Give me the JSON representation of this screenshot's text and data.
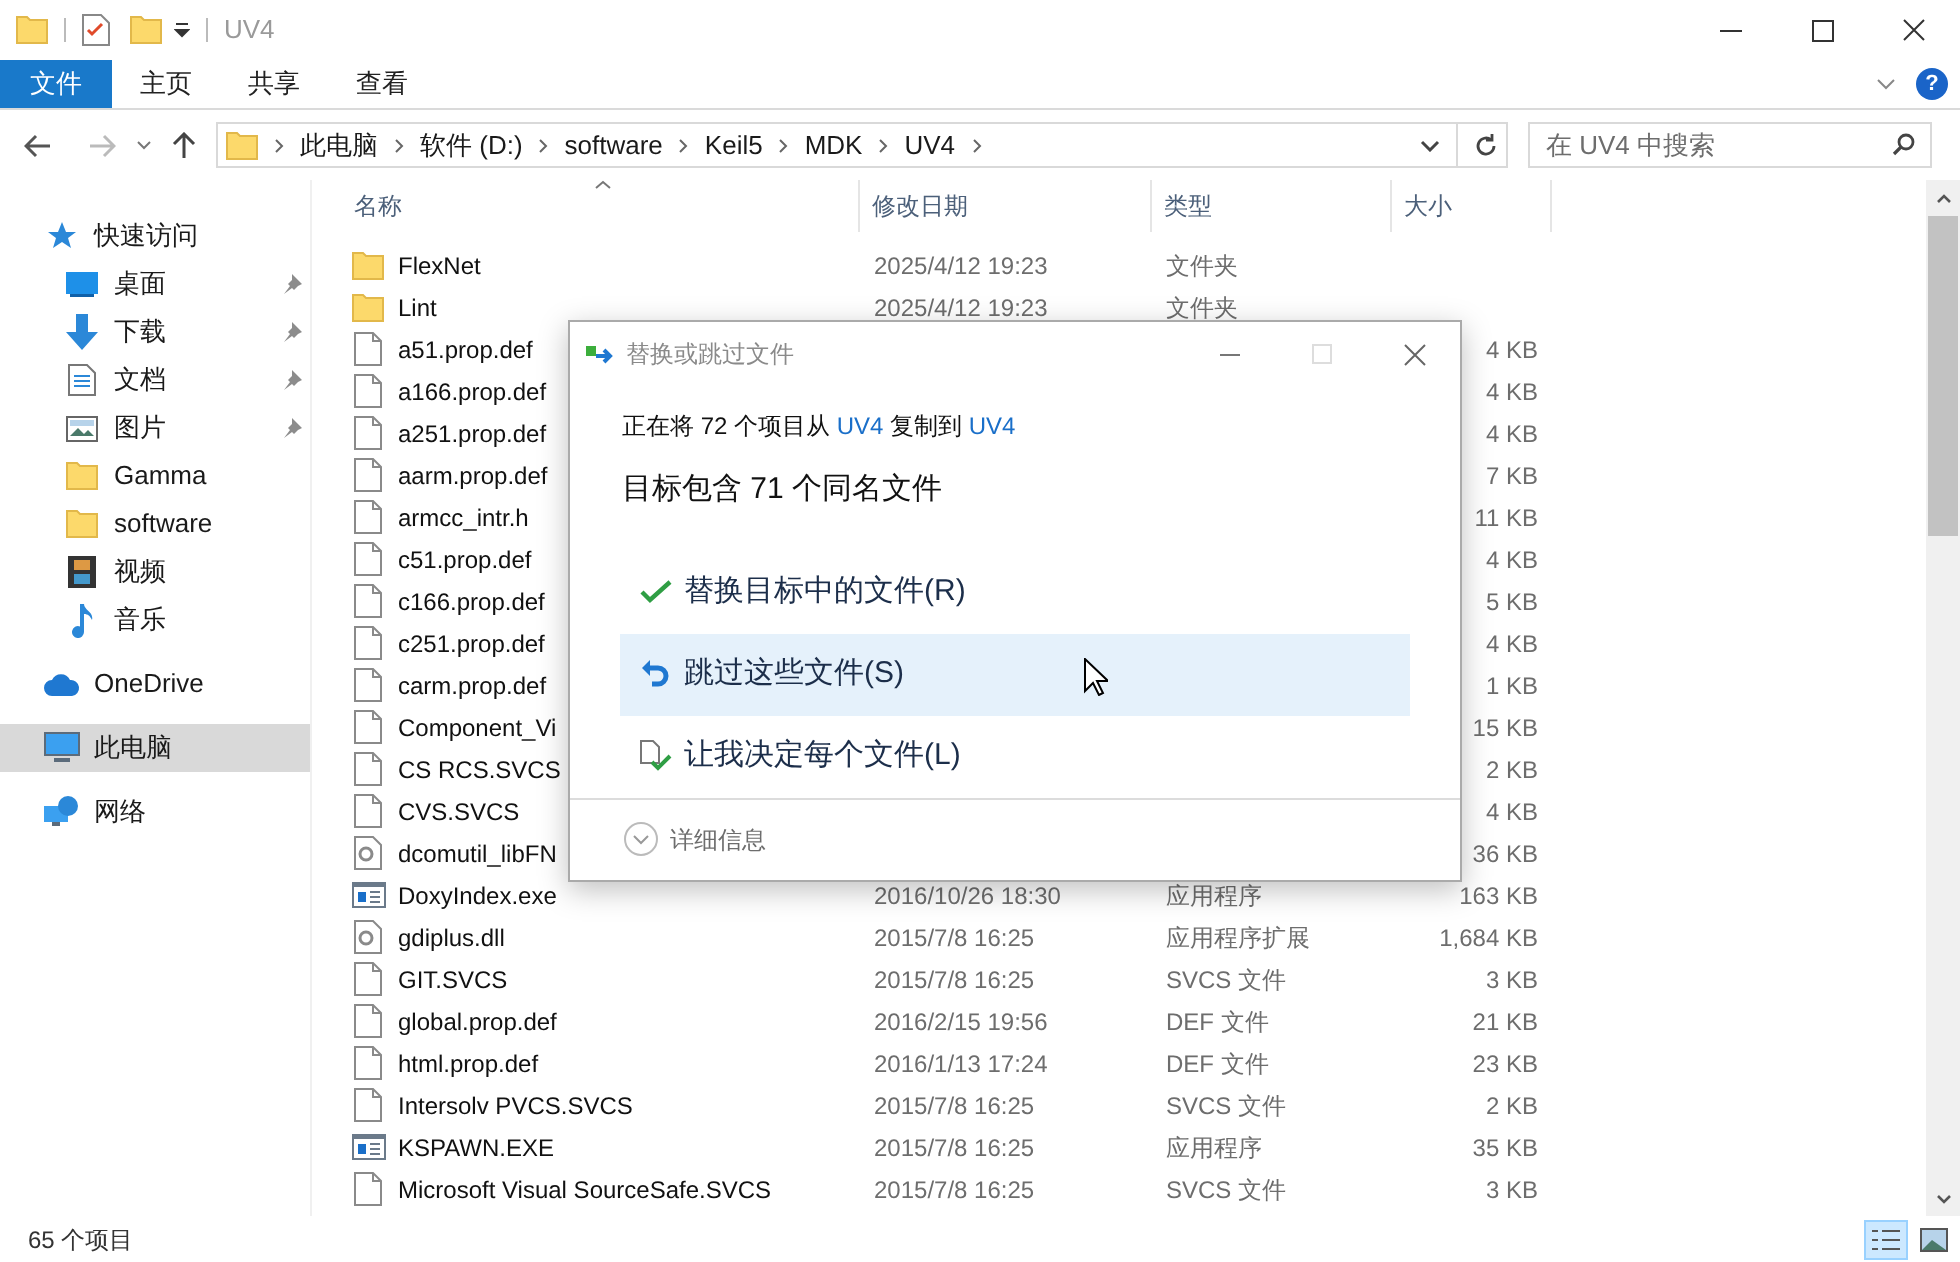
{
  "window": {
    "title": "UV4"
  },
  "ribbon_tabs": [
    {
      "label": "文件",
      "selected": true
    },
    {
      "label": "主页",
      "selected": false
    },
    {
      "label": "共享",
      "selected": false
    },
    {
      "label": "查看",
      "selected": false
    }
  ],
  "help": "?",
  "address": {
    "crumbs": [
      "此电脑",
      "软件 (D:)",
      "software",
      "Keil5",
      "MDK",
      "UV4"
    ]
  },
  "search": {
    "placeholder": "在 UV4 中搜索"
  },
  "sidebar": {
    "items": [
      {
        "label": "快速访问",
        "kind": "star",
        "selected": false,
        "children": [
          {
            "label": "桌面",
            "kind": "desktop",
            "pinned": true,
            "selected": false
          },
          {
            "label": "下载",
            "kind": "download",
            "pinned": true,
            "selected": false
          },
          {
            "label": "文档",
            "kind": "document",
            "pinned": true,
            "selected": false
          },
          {
            "label": "图片",
            "kind": "image",
            "pinned": true,
            "selected": false
          },
          {
            "label": "Gamma",
            "kind": "folder",
            "pinned": false,
            "selected": false
          },
          {
            "label": "software",
            "kind": "folder",
            "pinned": false,
            "selected": false
          },
          {
            "label": "视频",
            "kind": "video",
            "pinned": false,
            "selected": false
          },
          {
            "label": "音乐",
            "kind": "music",
            "pinned": false,
            "selected": false
          }
        ]
      },
      {
        "label": "OneDrive",
        "kind": "cloud",
        "selected": false
      },
      {
        "label": "此电脑",
        "kind": "computer",
        "selected": true
      },
      {
        "label": "网络",
        "kind": "network",
        "selected": false
      }
    ]
  },
  "table": {
    "columns": [
      "名称",
      "修改日期",
      "类型",
      "大小"
    ],
    "rows": [
      {
        "kind": "folder",
        "name": "FlexNet",
        "date": "2025/4/12 19:23",
        "type": "文件夹"
      },
      {
        "kind": "folder",
        "name": "Lint",
        "date": "2025/4/12 19:23",
        "type": "文件夹"
      },
      {
        "kind": "file",
        "name": "a51.prop.def",
        "size": "4 KB"
      },
      {
        "kind": "file",
        "name": "a166.prop.def",
        "size": "4 KB"
      },
      {
        "kind": "file",
        "name": "a251.prop.def",
        "size": "4 KB"
      },
      {
        "kind": "file",
        "name": "aarm.prop.def",
        "size": "7 KB"
      },
      {
        "kind": "file",
        "name": "armcc_intr.h",
        "size": "11 KB"
      },
      {
        "kind": "file",
        "name": "c51.prop.def",
        "size": "4 KB"
      },
      {
        "kind": "file",
        "name": "c166.prop.def",
        "size": "5 KB"
      },
      {
        "kind": "file",
        "name": "c251.prop.def",
        "size": "4 KB"
      },
      {
        "kind": "file",
        "name": "carm.prop.def",
        "size": "1 KB"
      },
      {
        "kind": "file",
        "name": "Component_Vi",
        "size": "15 KB"
      },
      {
        "kind": "file",
        "name": "CS RCS.SVCS",
        "size": "2 KB"
      },
      {
        "kind": "file",
        "name": "CVS.SVCS",
        "size": "4 KB"
      },
      {
        "kind": "dll",
        "name": "dcomutil_libFN",
        "size": "36 KB"
      },
      {
        "kind": "exe",
        "name": "DoxyIndex.exe",
        "date": "2016/10/26 18:30",
        "type": "应用程序",
        "size": "163 KB"
      },
      {
        "kind": "dll",
        "name": "gdiplus.dll",
        "date": "2015/7/8 16:25",
        "type": "应用程序扩展",
        "size": "1,684 KB"
      },
      {
        "kind": "file",
        "name": "GIT.SVCS",
        "date": "2015/7/8 16:25",
        "type": "SVCS 文件",
        "size": "3 KB"
      },
      {
        "kind": "file",
        "name": "global.prop.def",
        "date": "2016/2/15 19:56",
        "type": "DEF 文件",
        "size": "21 KB"
      },
      {
        "kind": "file",
        "name": "html.prop.def",
        "date": "2016/1/13 17:24",
        "type": "DEF 文件",
        "size": "23 KB"
      },
      {
        "kind": "file",
        "name": "Intersolv PVCS.SVCS",
        "date": "2015/7/8 16:25",
        "type": "SVCS 文件",
        "size": "2 KB"
      },
      {
        "kind": "exe",
        "name": "KSPAWN.EXE",
        "date": "2015/7/8 16:25",
        "type": "应用程序",
        "size": "35 KB"
      },
      {
        "kind": "file",
        "name": "Microsoft Visual SourceSafe.SVCS",
        "date": "2015/7/8 16:25",
        "type": "SVCS 文件",
        "size": "3 KB"
      }
    ]
  },
  "status_bar": {
    "count": "65 个项目",
    "views": [
      {
        "kind": "details",
        "selected": true
      },
      {
        "kind": "large",
        "selected": false
      }
    ]
  },
  "dialog": {
    "title": "替换或跳过文件",
    "copy_line": {
      "before": "正在将 72 个项目从",
      "source": "UV4",
      "middle": "复制到",
      "target": "UV4"
    },
    "heading": "目标包含 71 个同名文件",
    "options": [
      {
        "kind": "replace",
        "label": "替换目标中的文件(R)",
        "selected": false
      },
      {
        "kind": "skip",
        "label": "跳过这些文件(S)",
        "selected": true
      },
      {
        "kind": "decide",
        "label": "让我决定每个文件(L)",
        "selected": false
      }
    ],
    "details": "详细信息"
  }
}
